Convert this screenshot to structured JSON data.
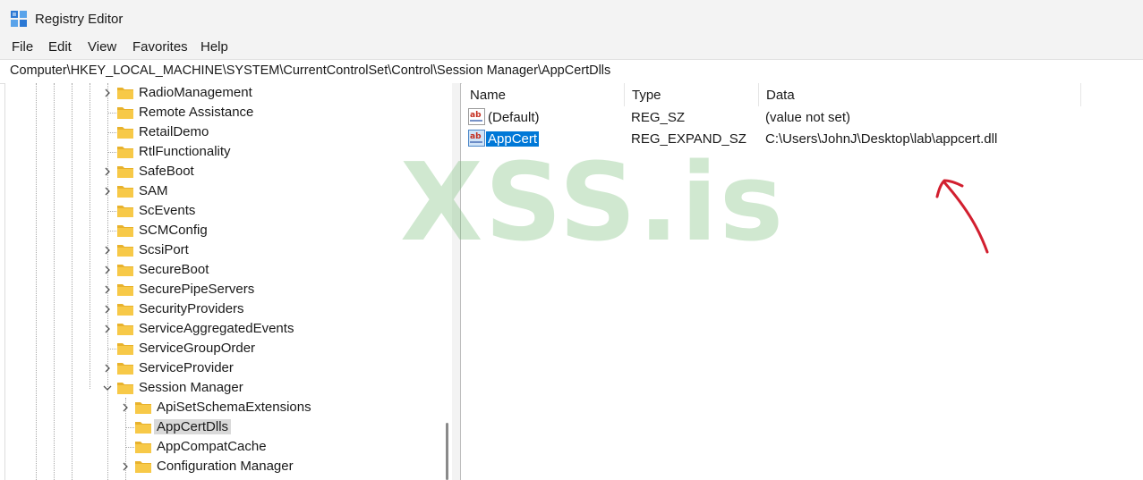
{
  "window": {
    "title": "Registry Editor"
  },
  "menu": [
    "File",
    "Edit",
    "View",
    "Favorites",
    "Help"
  ],
  "address": {
    "path": "Computer\\HKEY_LOCAL_MACHINE\\SYSTEM\\CurrentControlSet\\Control\\Session Manager\\AppCertDlls"
  },
  "tree": {
    "items": [
      {
        "label": "RadioManagement",
        "expander": "collapsed"
      },
      {
        "label": "Remote Assistance",
        "expander": "none"
      },
      {
        "label": "RetailDemo",
        "expander": "none"
      },
      {
        "label": "RtlFunctionality",
        "expander": "none"
      },
      {
        "label": "SafeBoot",
        "expander": "collapsed"
      },
      {
        "label": "SAM",
        "expander": "collapsed"
      },
      {
        "label": "ScEvents",
        "expander": "none"
      },
      {
        "label": "SCMConfig",
        "expander": "none"
      },
      {
        "label": "ScsiPort",
        "expander": "collapsed"
      },
      {
        "label": "SecureBoot",
        "expander": "collapsed"
      },
      {
        "label": "SecurePipeServers",
        "expander": "collapsed"
      },
      {
        "label": "SecurityProviders",
        "expander": "collapsed"
      },
      {
        "label": "ServiceAggregatedEvents",
        "expander": "collapsed"
      },
      {
        "label": "ServiceGroupOrder",
        "expander": "none"
      },
      {
        "label": "ServiceProvider",
        "expander": "collapsed"
      },
      {
        "label": "Session Manager",
        "expander": "expanded"
      },
      {
        "label": "ApiSetSchemaExtensions",
        "expander": "collapsed",
        "child": true
      },
      {
        "label": "AppCertDlls",
        "expander": "none",
        "child": true,
        "selected": true
      },
      {
        "label": "AppCompatCache",
        "expander": "none",
        "child": true
      },
      {
        "label": "Configuration Manager",
        "expander": "collapsed",
        "child": true
      }
    ]
  },
  "values": {
    "columns": [
      "Name",
      "Type",
      "Data"
    ],
    "rows": [
      {
        "name": "(Default)",
        "type": "REG_SZ",
        "data": "(value not set)"
      },
      {
        "name": "AppCert",
        "type": "REG_EXPAND_SZ",
        "data": "C:\\Users\\JohnJ\\Desktop\\lab\\appcert.dll",
        "selected": true
      }
    ]
  },
  "watermark": "XSS.is",
  "colors": {
    "selection": "#0078d7",
    "tree_selection": "#d9d9d9",
    "folder": "#f7c948",
    "annotation_arrow": "#d21f2f",
    "watermark": "#78be78"
  }
}
